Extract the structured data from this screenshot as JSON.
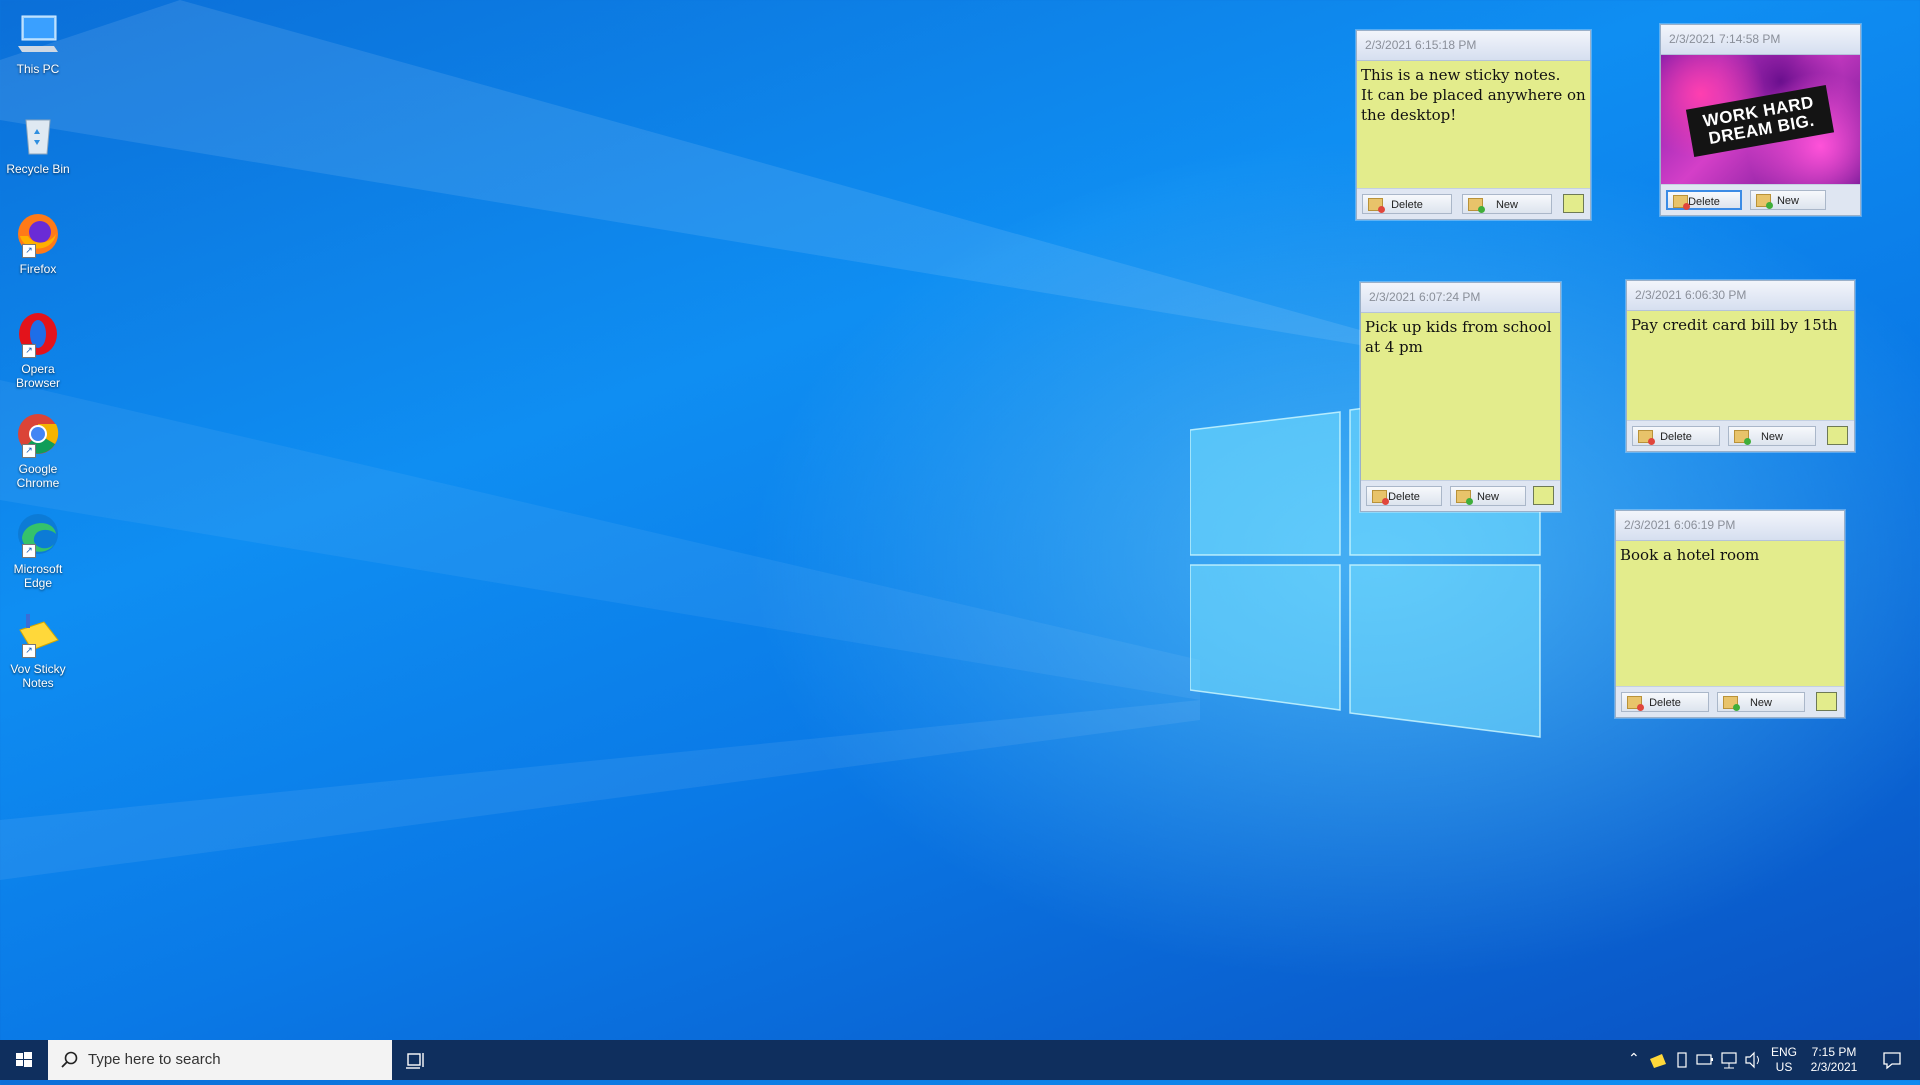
{
  "desktop_icons": [
    {
      "label": "This PC",
      "icon": "computer-icon"
    },
    {
      "label": "Recycle Bin",
      "icon": "recycle-bin-icon"
    },
    {
      "label": "Firefox",
      "icon": "firefox-icon"
    },
    {
      "label": "Opera Browser",
      "icon": "opera-icon"
    },
    {
      "label": "Google Chrome",
      "icon": "chrome-icon"
    },
    {
      "label": "Microsoft Edge",
      "icon": "edge-icon"
    },
    {
      "label": "Vov Sticky Notes",
      "icon": "sticky-notes-icon"
    }
  ],
  "notes": [
    {
      "timestamp": "2/3/2021 6:15:18 PM",
      "text": "This is a new sticky notes.\nIt can be placed anywhere on the desktop!",
      "delete_label": "Delete",
      "new_label": "New",
      "color": "#e3ec8c"
    },
    {
      "timestamp": "2/3/2021 7:14:58 PM",
      "image_text": "WORK HARD DREAM BIG.",
      "delete_label": "Delete",
      "new_label": "New"
    },
    {
      "timestamp": "2/3/2021 6:07:24 PM",
      "text": "Pick up kids from school at 4 pm",
      "delete_label": "Delete",
      "new_label": "New",
      "color": "#e3ec8c"
    },
    {
      "timestamp": "2/3/2021 6:06:30 PM",
      "text": "Pay credit card bill by 15th",
      "delete_label": "Delete",
      "new_label": "New",
      "color": "#e3ec8c"
    },
    {
      "timestamp": "2/3/2021 6:06:19 PM",
      "text": "Book a hotel room",
      "delete_label": "Delete",
      "new_label": "New",
      "color": "#e3ec8c"
    }
  ],
  "taskbar": {
    "search_placeholder": "Type here to search",
    "language": "ENG",
    "region": "US",
    "time": "7:15 PM",
    "date": "2/3/2021"
  }
}
